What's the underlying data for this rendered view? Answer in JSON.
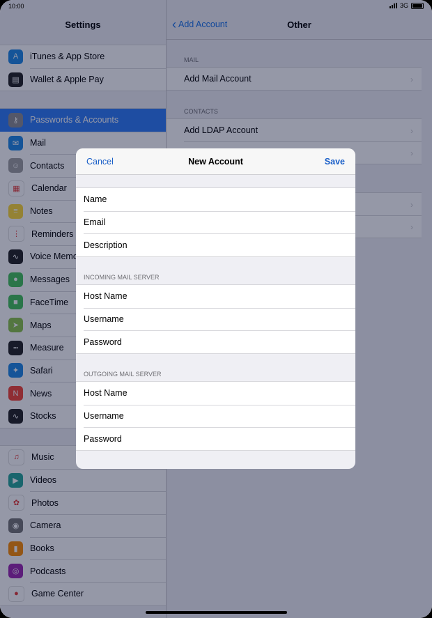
{
  "status": {
    "time": "10:00",
    "network": "3G"
  },
  "sidebar": {
    "title": "Settings",
    "groups": [
      {
        "items": [
          {
            "label": "iTunes & App Store",
            "icon": "app-store-icon",
            "color": "#1e88e5",
            "glyph": "A"
          },
          {
            "label": "Wallet & Apple Pay",
            "icon": "wallet-icon",
            "color": "#222222",
            "glyph": "▤"
          }
        ]
      },
      {
        "items": [
          {
            "label": "Passwords & Accounts",
            "icon": "key-icon",
            "color": "#8e8e93",
            "glyph": "⚷",
            "selected": true
          },
          {
            "label": "Mail",
            "icon": "mail-icon",
            "color": "#1e88e5",
            "glyph": "✉"
          },
          {
            "label": "Contacts",
            "icon": "contacts-icon",
            "color": "#9e9e9e",
            "glyph": "☺"
          },
          {
            "label": "Calendar",
            "icon": "calendar-icon",
            "color": "#ffffff",
            "glyph": "▦"
          },
          {
            "label": "Notes",
            "icon": "notes-icon",
            "color": "#fdd835",
            "glyph": "≡"
          },
          {
            "label": "Reminders",
            "icon": "reminders-icon",
            "color": "#ffffff",
            "glyph": "⋮"
          },
          {
            "label": "Voice Memos",
            "icon": "voice-memos-icon",
            "color": "#222222",
            "glyph": "∿"
          },
          {
            "label": "Messages",
            "icon": "messages-icon",
            "color": "#43c25b",
            "glyph": "●"
          },
          {
            "label": "FaceTime",
            "icon": "facetime-icon",
            "color": "#43c25b",
            "glyph": "■"
          },
          {
            "label": "Maps",
            "icon": "maps-icon",
            "color": "#8bc34a",
            "glyph": "➤"
          },
          {
            "label": "Measure",
            "icon": "measure-icon",
            "color": "#222222",
            "glyph": "┅"
          },
          {
            "label": "Safari",
            "icon": "safari-icon",
            "color": "#1e88e5",
            "glyph": "✦"
          },
          {
            "label": "News",
            "icon": "news-icon",
            "color": "#f44336",
            "glyph": "N"
          },
          {
            "label": "Stocks",
            "icon": "stocks-icon",
            "color": "#222222",
            "glyph": "∿"
          }
        ]
      },
      {
        "items": [
          {
            "label": "Music",
            "icon": "music-icon",
            "color": "#ffffff",
            "glyph": "♫"
          },
          {
            "label": "Videos",
            "icon": "videos-icon",
            "color": "#26a69a",
            "glyph": "▶"
          },
          {
            "label": "Photos",
            "icon": "photos-icon",
            "color": "#ffffff",
            "glyph": "✿"
          },
          {
            "label": "Camera",
            "icon": "camera-icon",
            "color": "#757575",
            "glyph": "◉"
          },
          {
            "label": "Books",
            "icon": "books-icon",
            "color": "#fb8c00",
            "glyph": "▮"
          },
          {
            "label": "Podcasts",
            "icon": "podcasts-icon",
            "color": "#9c27b0",
            "glyph": "◎"
          },
          {
            "label": "Game Center",
            "icon": "game-center-icon",
            "color": "#ffffff",
            "glyph": "●"
          }
        ]
      }
    ]
  },
  "detail": {
    "back_label": "Add Account",
    "title": "Other",
    "sections": [
      {
        "header": "MAIL",
        "items": [
          "Add Mail Account"
        ]
      },
      {
        "header": "CONTACTS",
        "items": [
          "Add LDAP Account",
          ""
        ]
      },
      {
        "header": "",
        "items": [
          "",
          ""
        ]
      }
    ]
  },
  "modal": {
    "cancel_label": "Cancel",
    "title": "New Account",
    "save_label": "Save",
    "account_fields": [
      "Name",
      "Email",
      "Description"
    ],
    "incoming_header": "INCOMING MAIL SERVER",
    "incoming_fields": [
      "Host Name",
      "Username",
      "Password"
    ],
    "outgoing_header": "OUTGOING MAIL SERVER",
    "outgoing_fields": [
      "Host Name",
      "Username",
      "Password"
    ]
  }
}
